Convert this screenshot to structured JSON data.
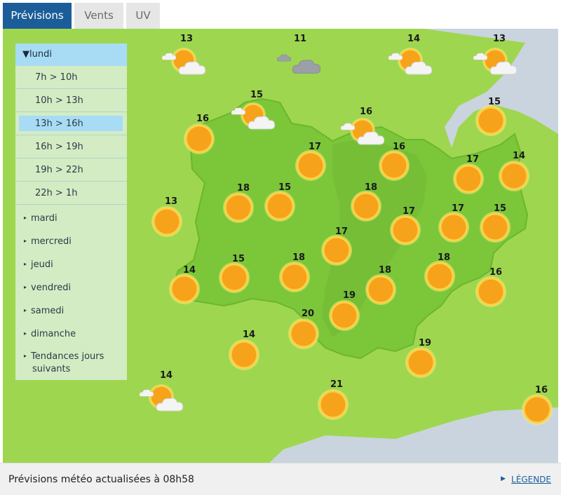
{
  "tabs": [
    {
      "label": "Prévisions",
      "active": true
    },
    {
      "label": "Vents",
      "active": false
    },
    {
      "label": "UV",
      "active": false
    }
  ],
  "sidebar": {
    "day": "lundi",
    "slots": [
      "7h > 10h",
      "10h > 13h",
      "13h > 16h",
      "16h > 19h",
      "19h > 22h",
      "22h > 1h"
    ],
    "active_slot": "13h > 16h",
    "other_days": [
      "mardi",
      "mercredi",
      "jeudi",
      "vendredi",
      "samedi",
      "dimanche"
    ],
    "trend": [
      "Tendances jours",
      "suivants"
    ]
  },
  "forecast": [
    {
      "temp": "13",
      "icon": "sun-cloud-icon"
    },
    {
      "temp": "11",
      "icon": "cloud-icon"
    },
    {
      "temp": "14",
      "icon": "sun-cloud-icon"
    },
    {
      "temp": "13",
      "icon": "sun-cloud-icon"
    },
    {
      "temp": "15",
      "icon": "sun-cloud-icon"
    },
    {
      "temp": "16",
      "icon": "sun-cloud-icon"
    },
    {
      "temp": "15",
      "icon": "sun-icon"
    },
    {
      "temp": "16",
      "icon": "sun-icon"
    },
    {
      "temp": "17",
      "icon": "sun-icon"
    },
    {
      "temp": "16",
      "icon": "sun-icon"
    },
    {
      "temp": "17",
      "icon": "sun-icon"
    },
    {
      "temp": "14",
      "icon": "sun-icon"
    },
    {
      "temp": "13",
      "icon": "sun-icon"
    },
    {
      "temp": "18",
      "icon": "sun-icon"
    },
    {
      "temp": "15",
      "icon": "sun-icon"
    },
    {
      "temp": "18",
      "icon": "sun-icon"
    },
    {
      "temp": "17",
      "icon": "sun-icon"
    },
    {
      "temp": "17",
      "icon": "sun-icon"
    },
    {
      "temp": "15",
      "icon": "sun-icon"
    },
    {
      "temp": "17",
      "icon": "sun-icon"
    },
    {
      "temp": "14",
      "icon": "sun-icon"
    },
    {
      "temp": "15",
      "icon": "sun-icon"
    },
    {
      "temp": "18",
      "icon": "sun-icon"
    },
    {
      "temp": "18",
      "icon": "sun-icon"
    },
    {
      "temp": "18",
      "icon": "sun-icon"
    },
    {
      "temp": "16",
      "icon": "sun-icon"
    },
    {
      "temp": "19",
      "icon": "sun-icon"
    },
    {
      "temp": "20",
      "icon": "sun-icon"
    },
    {
      "temp": "14",
      "icon": "sun-icon"
    },
    {
      "temp": "19",
      "icon": "sun-icon"
    },
    {
      "temp": "14",
      "icon": "sun-cloud-icon"
    },
    {
      "temp": "21",
      "icon": "sun-icon"
    },
    {
      "temp": "16",
      "icon": "sun-icon"
    }
  ],
  "footer": {
    "text": "Prévisions météo actualisées à 08h58",
    "legend_link": "LÉGENDE"
  },
  "colors": {
    "tab_active": "#1b5d98",
    "region": "#7cc63a",
    "surrounding": "#a6d95a",
    "water": "#c9d4de",
    "sun": "#f7a21b"
  }
}
